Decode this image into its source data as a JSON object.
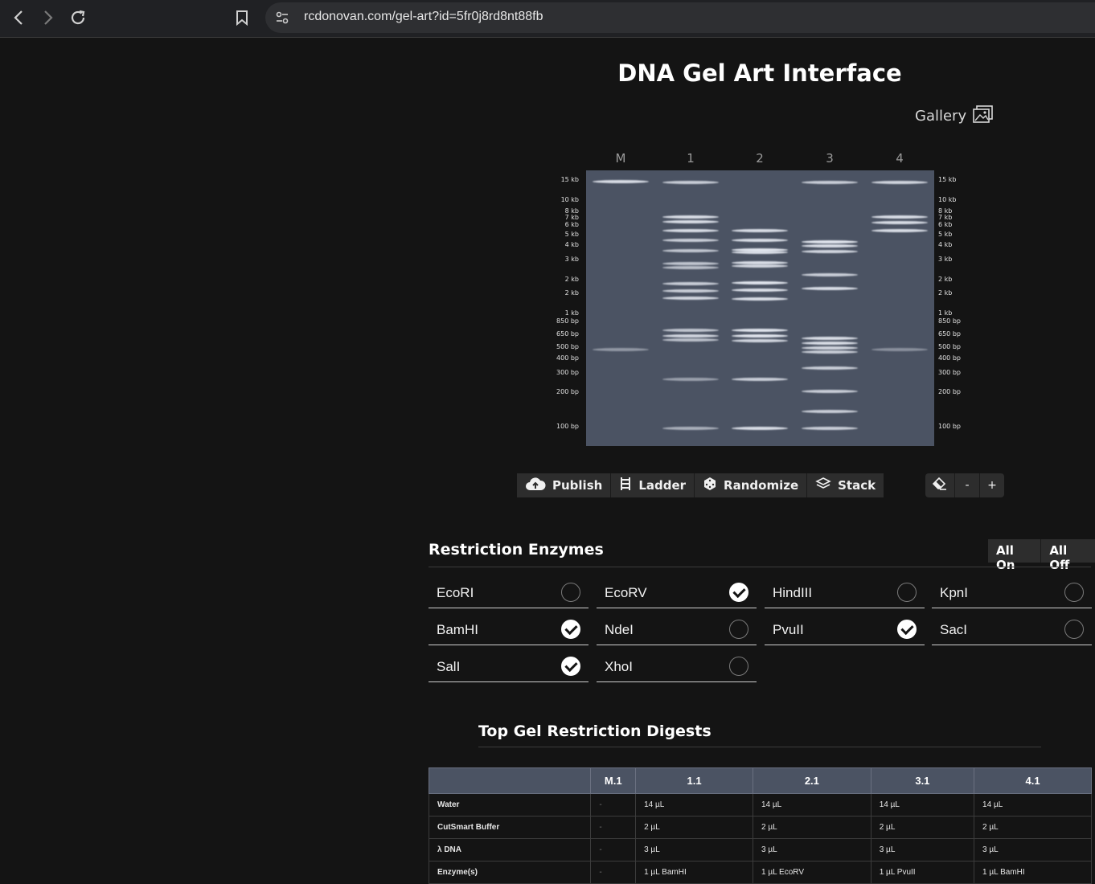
{
  "browser": {
    "url": "rcdonovan.com/gel-art?id=5fr0j8rd8nt88fb"
  },
  "page": {
    "title": "DNA Gel Art Interface",
    "gallery_label": "Gallery"
  },
  "gel": {
    "lanes": [
      "M",
      "1",
      "2",
      "3",
      "4"
    ],
    "size_labels": [
      "15 kb",
      "10 kb",
      "8 kb",
      "7 kb",
      "6 kb",
      "5 kb",
      "4 kb",
      "3 kb",
      "2 kb",
      "2 kb",
      "1 kb",
      "850 bp",
      "650 bp",
      "500 bp",
      "400 bp",
      "300 bp",
      "200 bp",
      "100 bp"
    ],
    "band_color": "#e8ecf4",
    "gel_color": "#4b5363"
  },
  "toolbar": {
    "publish": "Publish",
    "ladder": "Ladder",
    "randomize": "Randomize",
    "stack": "Stack",
    "minus": "-",
    "plus": "+"
  },
  "enzymes_section": {
    "heading": "Restriction Enzymes",
    "all_on": "All On",
    "all_off": "All Off",
    "items": [
      {
        "name": "EcoRI",
        "checked": false
      },
      {
        "name": "EcoRV",
        "checked": true
      },
      {
        "name": "HindIII",
        "checked": false
      },
      {
        "name": "KpnI",
        "checked": false
      },
      {
        "name": "BamHI",
        "checked": true
      },
      {
        "name": "NdeI",
        "checked": false
      },
      {
        "name": "PvuII",
        "checked": true
      },
      {
        "name": "SacI",
        "checked": false
      },
      {
        "name": "SalI",
        "checked": true
      },
      {
        "name": "XhoI",
        "checked": false
      }
    ]
  },
  "digests": {
    "heading": "Top Gel Restriction Digests",
    "columns": [
      "",
      "M.1",
      "1.1",
      "2.1",
      "3.1",
      "4.1"
    ],
    "rows": [
      [
        "Water",
        "-",
        "14 µL",
        "14 µL",
        "14 µL",
        "14 µL"
      ],
      [
        "CutSmart Buffer",
        "-",
        "2 µL",
        "2 µL",
        "2 µL",
        "2 µL"
      ],
      [
        "λ DNA",
        "-",
        "3 µL",
        "3 µL",
        "3 µL",
        "3 µL"
      ],
      [
        "Enzyme(s)",
        "-",
        "1 µL BamHI",
        "1 µL EcoRV",
        "1 µL PvuII",
        "1 µL BamHI"
      ]
    ]
  }
}
